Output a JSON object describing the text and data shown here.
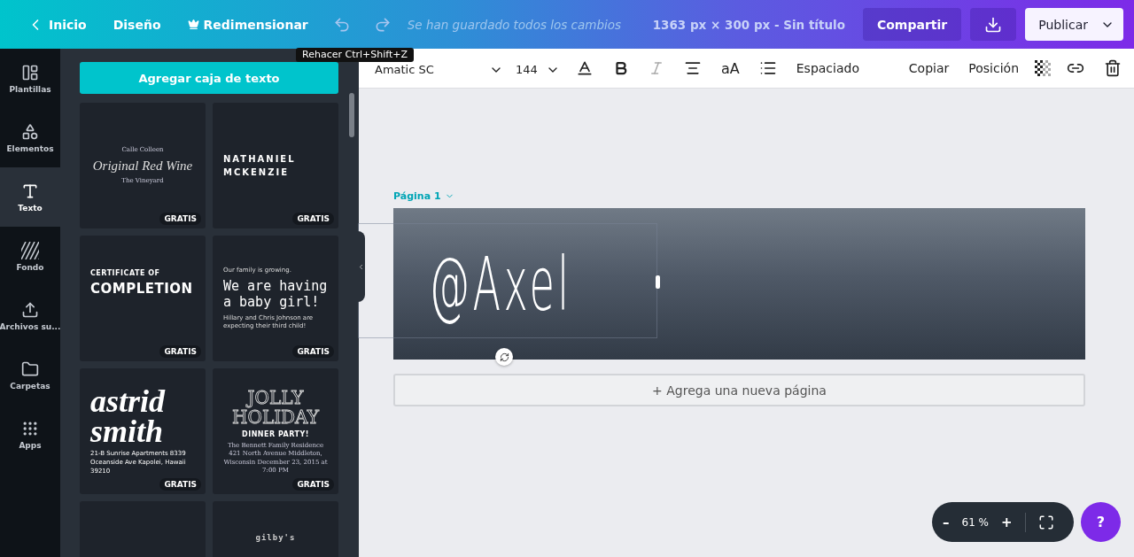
{
  "topbar": {
    "back": "Inicio",
    "design": "Diseño",
    "resize": "Redimensionar",
    "saved": "Se han guardado todos los cambios",
    "doc_info": "1363 px × 300 px - Sin título",
    "share": "Compartir",
    "publish": "Publicar"
  },
  "tooltip": "Rehacer Ctrl+Shift+Z",
  "rail": [
    {
      "label": "Plantillas",
      "selected": false
    },
    {
      "label": "Elementos",
      "selected": false
    },
    {
      "label": "Texto",
      "selected": true
    },
    {
      "label": "Fondo",
      "selected": false
    },
    {
      "label": "Archivos su...",
      "selected": false
    },
    {
      "label": "Carpetas",
      "selected": false
    },
    {
      "label": "Apps",
      "selected": false
    }
  ],
  "panel": {
    "add_button": "Agregar caja de texto",
    "cards": [
      {
        "badge": "GRATIS",
        "lines": [
          {
            "kind": "tiny-serif",
            "text": "Calle Colleen"
          },
          {
            "kind": "serif-italic",
            "text": "Original Red Wine"
          },
          {
            "kind": "tiny-serif",
            "text": "The Vineyard"
          }
        ]
      },
      {
        "badge": "GRATIS",
        "lines": [
          {
            "kind": "spaced-caps",
            "text": "NATHANIEL"
          },
          {
            "kind": "spaced-caps",
            "text": "MCKENZIE"
          }
        ]
      },
      {
        "badge": "GRATIS",
        "lines": [
          {
            "kind": "small-caps",
            "text": "CERTIFICATE OF"
          },
          {
            "kind": "bold-caps",
            "text": "COMPLETION"
          }
        ]
      },
      {
        "badge": "GRATIS",
        "lines": [
          {
            "kind": "hand-small",
            "text": "Our family is growing."
          },
          {
            "kind": "hand-large",
            "text": "We are having a baby girl!"
          },
          {
            "kind": "hand-small",
            "text": "Hillary and Chris Johnson are expecting their third child!"
          }
        ]
      },
      {
        "badge": "GRATIS",
        "lines": [
          {
            "kind": "script-large",
            "text": "astrid smith"
          },
          {
            "kind": "plain-small",
            "text": "21-B Sunrise Apartments 8339 Oceanside Ave Kapolei, Hawaii 39210"
          }
        ]
      },
      {
        "badge": "GRATIS",
        "lines": [
          {
            "kind": "outline-serif",
            "text": "JOLLY HOLIDAY"
          },
          {
            "kind": "small-caps",
            "text": "DINNER PARTY!"
          },
          {
            "kind": "tiny-serif",
            "text": "The Bennett Family Residence 421 North Avenue Middleton, Wisconsin December 23, 2015 at 7:00 PM"
          }
        ]
      },
      {
        "lines": [
          {
            "kind": "mono-small",
            "text": "gilby's"
          }
        ]
      }
    ]
  },
  "toolbar": {
    "font": "Amatic SC",
    "size": "144",
    "bold": true,
    "italic": false,
    "case": "aA",
    "spacing": "Espaciado",
    "copy": "Copiar",
    "position": "Posición"
  },
  "canvas": {
    "page_label": "Página 1",
    "banner_text": "@Axel",
    "add_page": "+ Agrega una nueva página"
  },
  "zoom": {
    "value": "61 %",
    "minus": "–",
    "plus": "+",
    "help": "?"
  }
}
